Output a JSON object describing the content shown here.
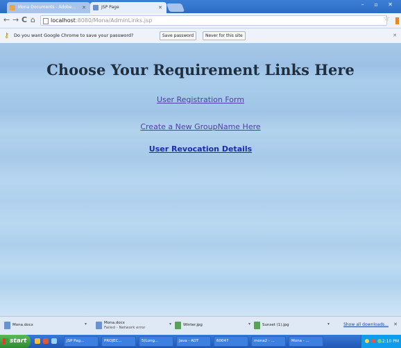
{
  "browser": {
    "tabs": [
      {
        "label": "Mona Documents - Adobe..."
      },
      {
        "label": "JSP Page"
      }
    ],
    "url_host": "localhost",
    "url_rest": ":8080/Mona/AdminLinks.jsp"
  },
  "password_bar": {
    "message": "Do you want Google Chrome to save your password?",
    "save_label": "Save password",
    "never_label": "Never for this site"
  },
  "page": {
    "heading": "Choose Your Requirement Links Here",
    "links": [
      "User Registration Form",
      "Create a New GroupName Here",
      "User Revocation Details"
    ]
  },
  "downloads": {
    "items": [
      {
        "name": "Mona.docx",
        "status": ""
      },
      {
        "name": "Mona.docx",
        "status": "Failed - Network error"
      },
      {
        "name": "Winter.jpg",
        "status": ""
      },
      {
        "name": "Sunset (1).jpg",
        "status": ""
      }
    ],
    "show_all_label": "Show all downloads..."
  },
  "taskbar": {
    "start_label": "start",
    "items": [
      "JSP Pag...",
      "PROJEC...",
      "5(Long...",
      "Java - ADT",
      "60047",
      "mona2 - ...",
      "Mona - ..."
    ],
    "clock": "12:10 PM"
  }
}
